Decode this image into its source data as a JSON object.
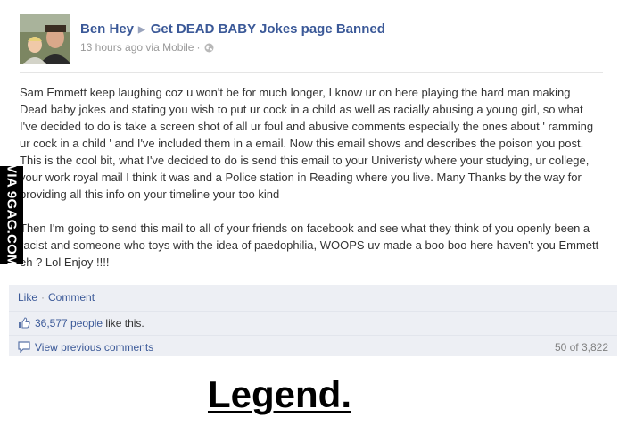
{
  "post": {
    "author": "Ben Hey",
    "target_page": "Get DEAD BABY Jokes page Banned",
    "timestamp": "13 hours ago",
    "via": "via Mobile",
    "separator_dot": "·",
    "paragraphs": [
      "Sam Emmett keep laughing coz u won't be for much longer, I know ur on here playing the hard man making Dead baby jokes and stating you wish to put ur cock in a child as well as racially abusing a young girl, so what I've decided to do is take a screen shot of all ur foul and abusive comments especially the ones about ' ramming ur cock in a child ' and I've included them in a email. Now this email shows and describes the poison you post. This is the cool bit, what I've decided to do is send this email to your Univeristy where your studying, ur college, your work royal mail I think it was and a Police station in Reading where you live. Many Thanks by the way for providing all this info on your timeline your too kind",
      "Then I'm going to send this mail to all of your friends on facebook and see what they think of you openly been a racist and someone who toys with the idea of paedophilia, WOOPS uv made a boo boo here haven't you Emmett eh ? Lol Enjoy !!!!"
    ]
  },
  "actions": {
    "like_label": "Like",
    "comment_label": "Comment",
    "separator_dot": "·"
  },
  "likes": {
    "count": "36,577 people",
    "suffix": "like this."
  },
  "comments": {
    "view_previous_label": "View previous comments",
    "count_label": "50 of 3,822"
  },
  "watermark": {
    "text": "VIA 9GAG.COM"
  },
  "caption": {
    "text": "Legend."
  },
  "icons": {
    "arrow": "arrow-right-icon",
    "globe": "globe-icon",
    "thumb": "thumbs-up-icon",
    "comment": "comment-bubble-icon"
  },
  "colors": {
    "link_blue": "#3b5998",
    "action_bar_bg": "#edeff4",
    "meta_gray": "#999999"
  }
}
